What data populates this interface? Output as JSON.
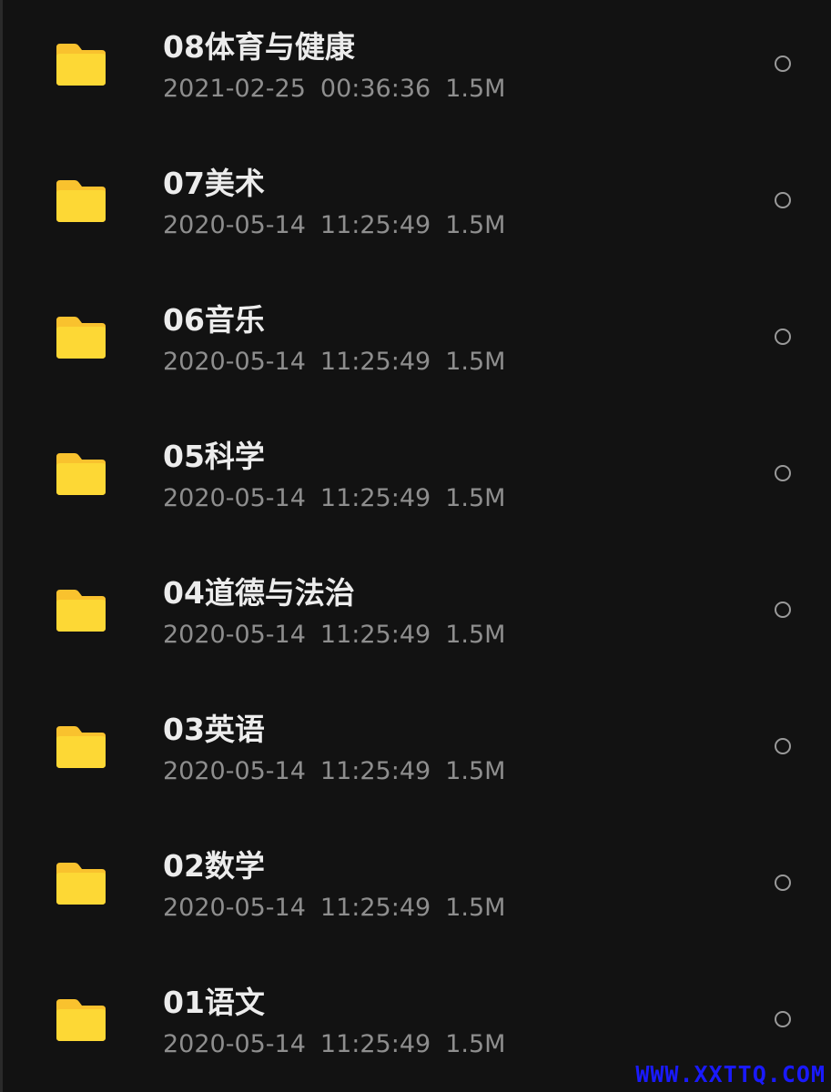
{
  "items": [
    {
      "name": "08体育与健康",
      "date": "2021-02-25",
      "time": "00:36:36",
      "size": "1.5M"
    },
    {
      "name": "07美术",
      "date": "2020-05-14",
      "time": "11:25:49",
      "size": "1.5M"
    },
    {
      "name": "06音乐",
      "date": "2020-05-14",
      "time": "11:25:49",
      "size": "1.5M"
    },
    {
      "name": "05科学",
      "date": "2020-05-14",
      "time": "11:25:49",
      "size": "1.5M"
    },
    {
      "name": "04道德与法治",
      "date": "2020-05-14",
      "time": "11:25:49",
      "size": "1.5M"
    },
    {
      "name": "03英语",
      "date": "2020-05-14",
      "time": "11:25:49",
      "size": "1.5M"
    },
    {
      "name": "02数学",
      "date": "2020-05-14",
      "time": "11:25:49",
      "size": "1.5M"
    },
    {
      "name": "01语文",
      "date": "2020-05-14",
      "time": "11:25:49",
      "size": "1.5M"
    }
  ],
  "icons": {
    "folder": "folder-icon",
    "select": "radio-circle-icon"
  },
  "colors": {
    "background": "#121212",
    "folder": "#FDD835",
    "folder_tab": "#F9C22E",
    "title_text": "#ececec",
    "meta_text": "#8e8e8e",
    "watermark": "#1a1aff"
  },
  "watermark": "WWW.XXTTQ.COM"
}
